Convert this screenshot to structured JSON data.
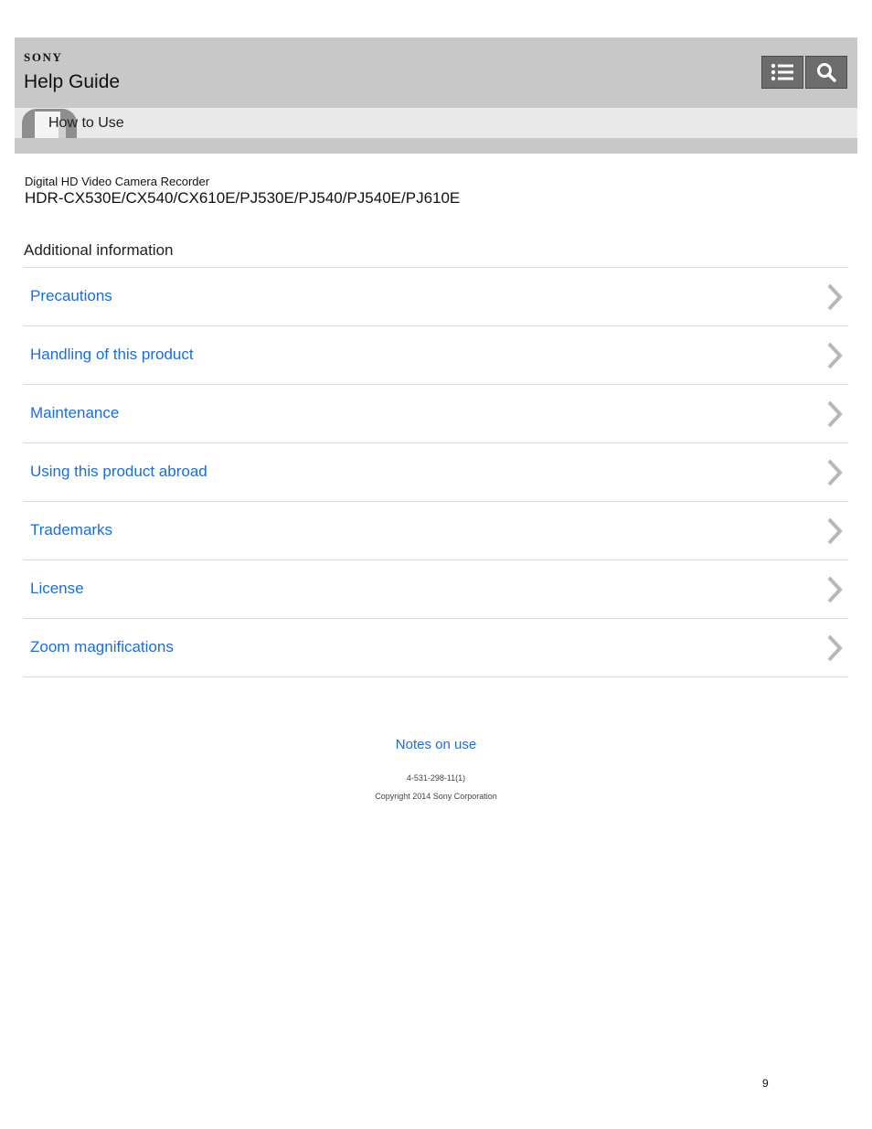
{
  "header": {
    "brand": "SONY",
    "title": "Help Guide",
    "toc_icon": "list-icon",
    "search_icon": "search-icon"
  },
  "subheader": {
    "label": "How to Use",
    "icon": "book-icon"
  },
  "product": {
    "name": "Digital HD Video Camera Recorder",
    "models": "HDR-CX530E/CX540/CX610E/PJ530E/PJ540/PJ540E/PJ610E"
  },
  "section": {
    "title": "Additional information",
    "items": [
      {
        "label": "Precautions"
      },
      {
        "label": "Handling of this product"
      },
      {
        "label": "Maintenance"
      },
      {
        "label": "Using this product abroad"
      },
      {
        "label": "Trademarks"
      },
      {
        "label": "License"
      },
      {
        "label": "Zoom magnifications"
      }
    ]
  },
  "footer": {
    "link": "Notes on use",
    "doc_code": "4-531-298-11(1)",
    "copyright": "Copyright 2014 Sony Corporation"
  },
  "page_number": "9",
  "colors": {
    "header_bg": "#c8c8c8",
    "subheader_bg": "#e9e9e9",
    "link": "#1a6de0",
    "button_bg": "#6c6c6c"
  }
}
